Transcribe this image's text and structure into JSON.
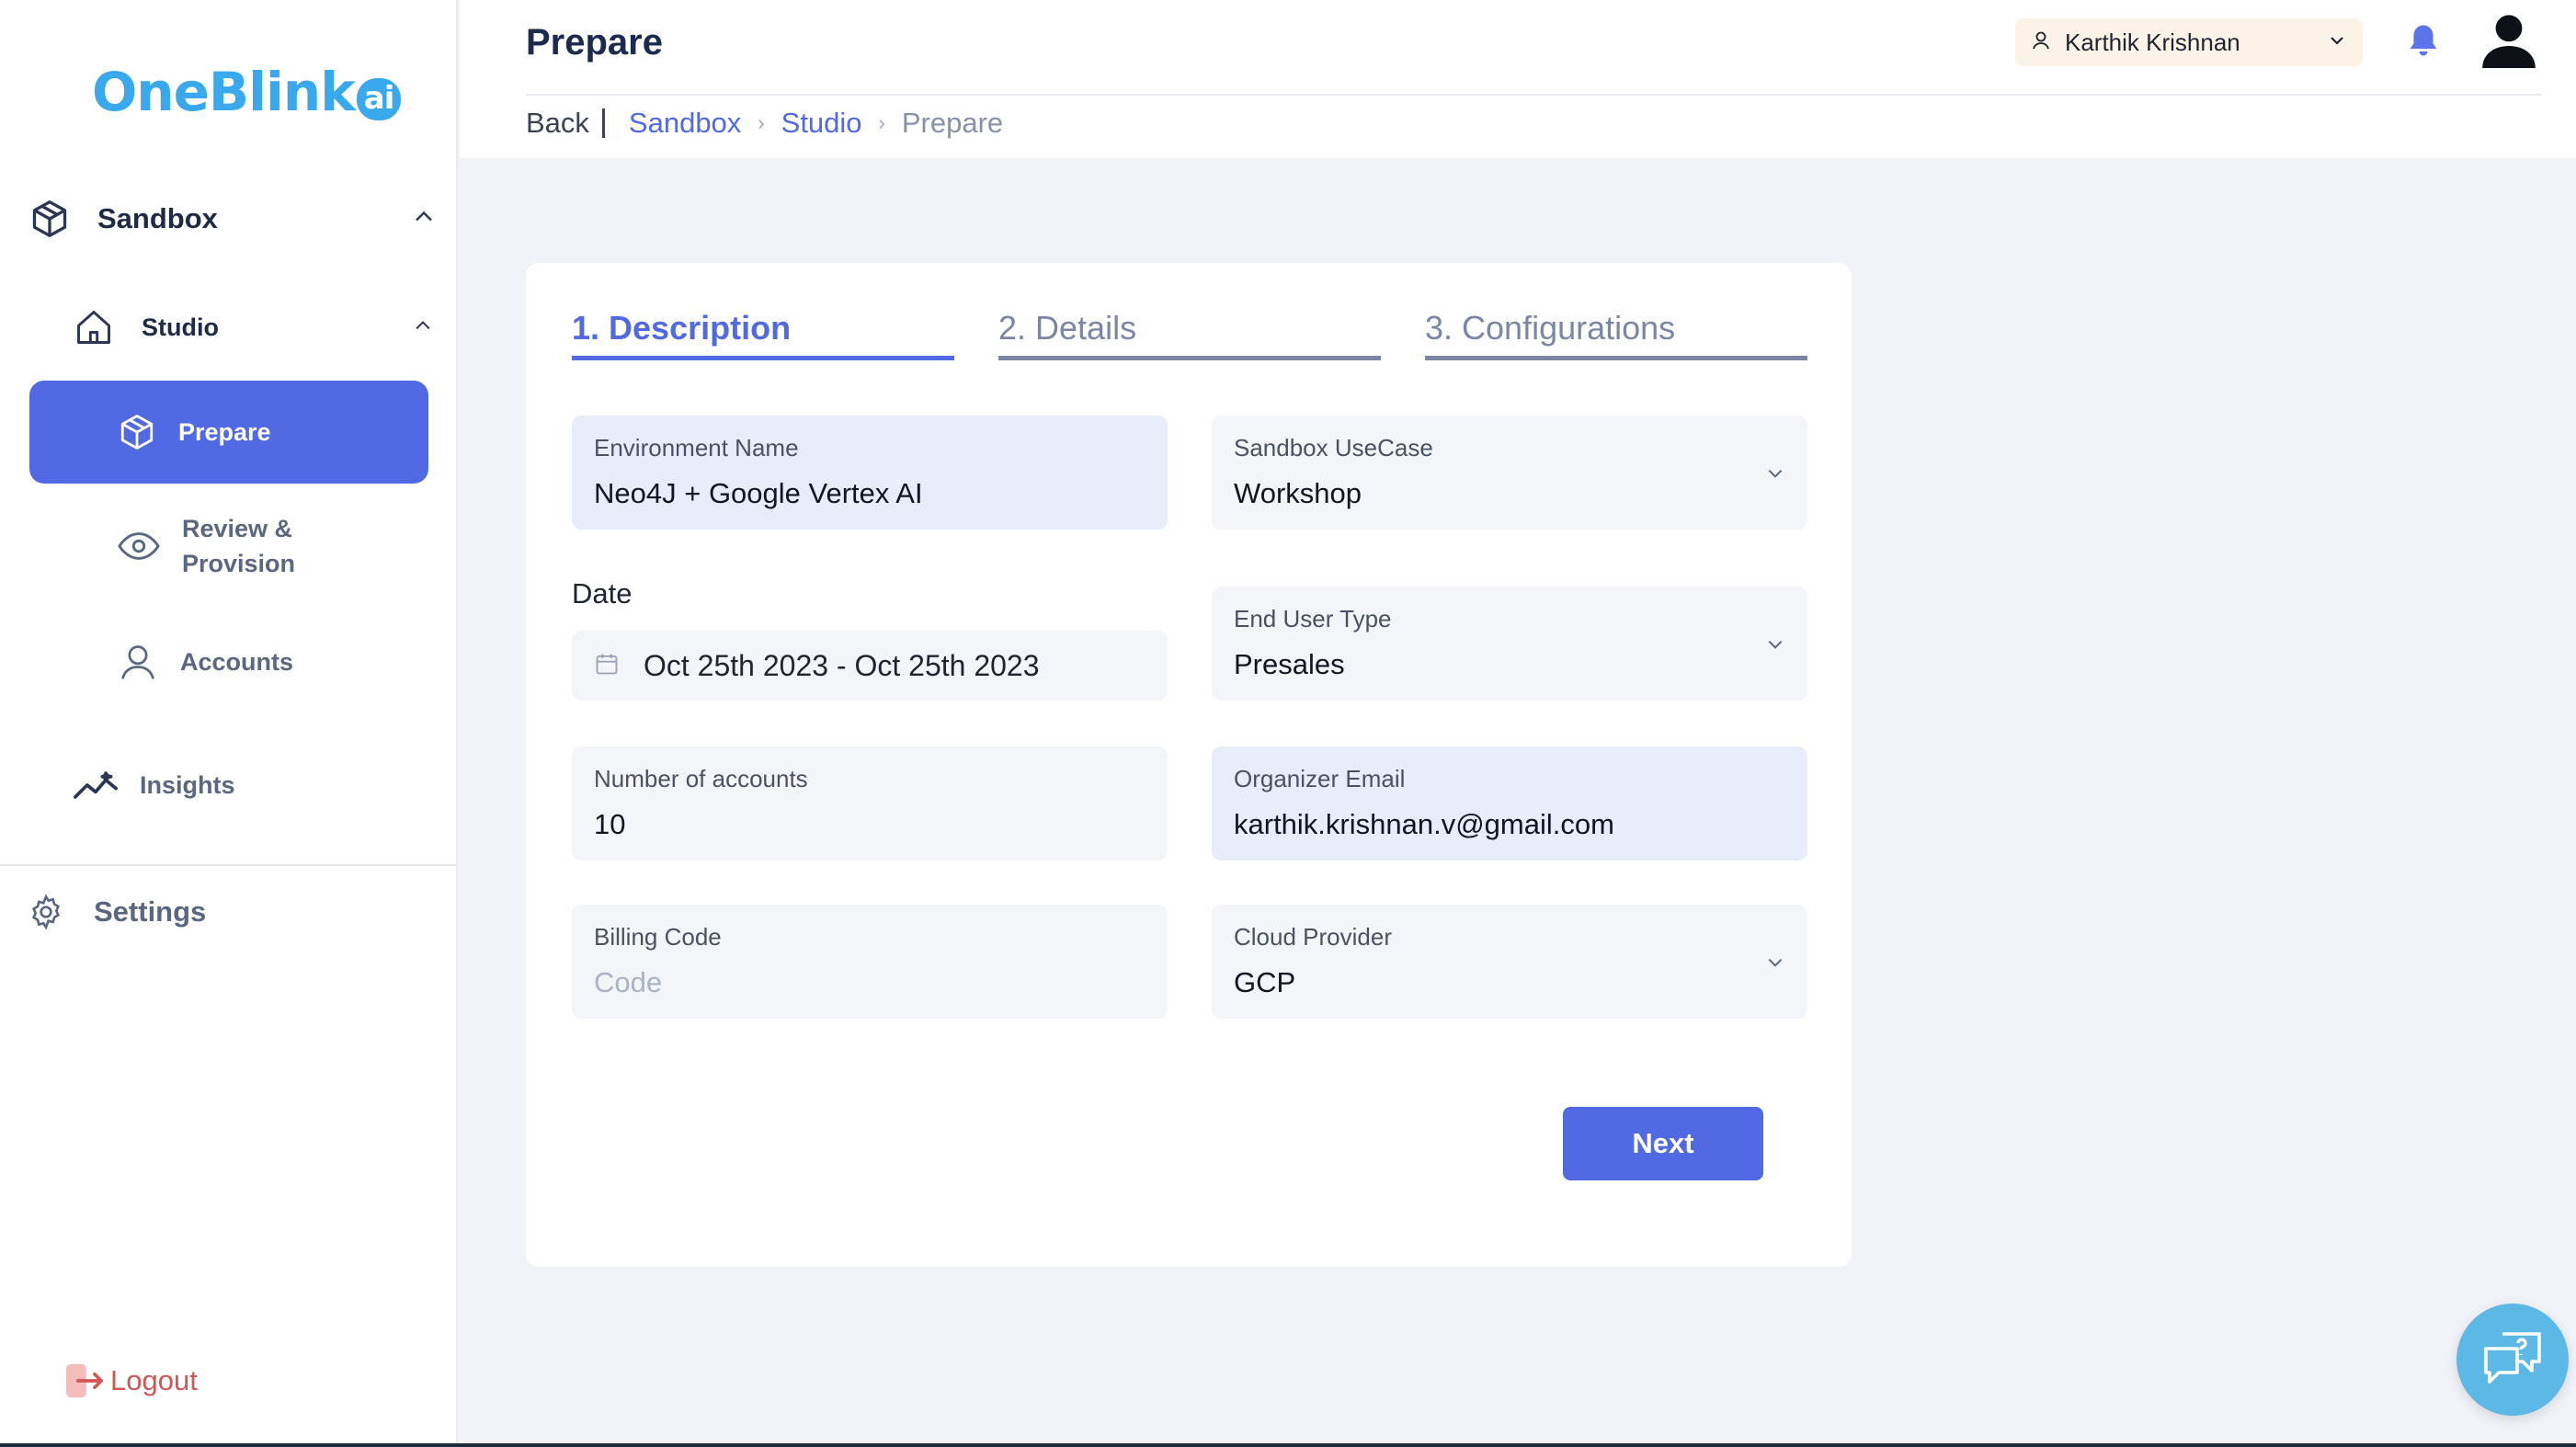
{
  "brand": {
    "logo_text": "OneBlink",
    "logo_suffix": "ai"
  },
  "sidebar": {
    "sandbox": "Sandbox",
    "studio": "Studio",
    "prepare": "Prepare",
    "review_line1": "Review &",
    "review_line2": "Provision",
    "accounts": "Accounts",
    "insights": "Insights",
    "settings": "Settings",
    "logout": "Logout"
  },
  "header": {
    "title": "Prepare",
    "user_name": "Karthik Krishnan"
  },
  "breadcrumb": {
    "back": "Back",
    "items": [
      "Sandbox",
      "Studio"
    ],
    "current": "Prepare"
  },
  "tabs": [
    "1. Description",
    "2. Details",
    "3. Configurations"
  ],
  "form": {
    "environment_name": {
      "label": "Environment Name",
      "value": "Neo4J + Google Vertex AI"
    },
    "sandbox_usecase": {
      "label": "Sandbox UseCase",
      "value": "Workshop"
    },
    "date": {
      "label": "Date",
      "value": "Oct 25th 2023 - Oct 25th 2023"
    },
    "end_user_type": {
      "label": "End User Type",
      "value": "Presales"
    },
    "number_of_accounts": {
      "label": "Number of accounts",
      "value": "10"
    },
    "organizer_email": {
      "label": "Organizer Email",
      "value": "karthik.krishnan.v@gmail.com"
    },
    "billing_code": {
      "label": "Billing Code",
      "placeholder": "Code"
    },
    "cloud_provider": {
      "label": "Cloud Provider",
      "value": "GCP"
    }
  },
  "actions": {
    "next": "Next"
  },
  "colors": {
    "accent": "#5169e3",
    "logo": "#3aa8ec",
    "logout": "#d25656",
    "chat_fab": "#5cb8e4"
  },
  "icons": {
    "sandbox": "cube-icon",
    "studio": "home-icon",
    "prepare": "cube-icon",
    "review": "eye-icon",
    "accounts": "user-icon",
    "insights": "trend-icon",
    "settings": "gear-icon",
    "logout": "logout-icon",
    "bell": "bell-icon",
    "avatar": "avatar-icon",
    "chat": "chat-help-icon",
    "date": "calendar-icon"
  }
}
